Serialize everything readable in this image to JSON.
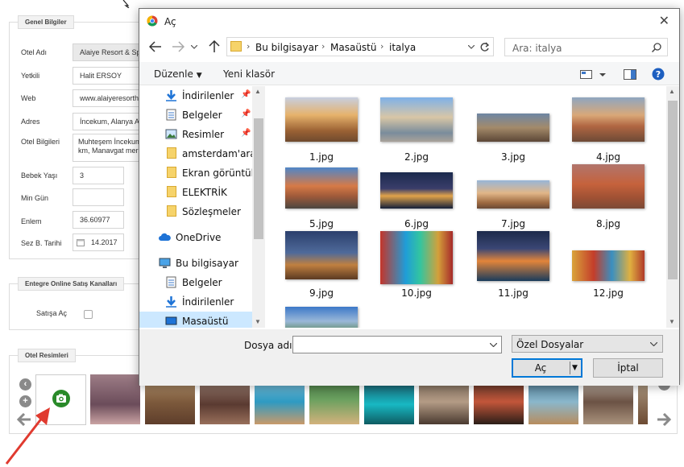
{
  "form": {
    "general_legend": "Genel Bilgiler",
    "fields": [
      {
        "label": "Otel Adı",
        "value": "Alaiye Resort & Spa H"
      },
      {
        "label": "Yetkili",
        "value": "Halit ERSOY"
      },
      {
        "label": "Web",
        "value": "www.alaiyeresorthot"
      },
      {
        "label": "Adres",
        "value": "İncekum,  Alanya Ant"
      },
      {
        "label": "Otel Bilgileri",
        "value_line1": "Muhteşem İncekum p",
        "value_line2": "km, Manavgat merke"
      },
      {
        "label": "Bebek Yaşı",
        "value": "3"
      },
      {
        "label": "Min Gün",
        "value": ""
      },
      {
        "label": "Enlem",
        "value": "36.60977"
      },
      {
        "label": "Sez B. Tarihi",
        "value": "14.2017"
      }
    ],
    "online_legend": "Entegre Online Satış Kanalları",
    "sales_open_label": "Satışa Aç",
    "images_legend": "Otel Resimleri"
  },
  "dialog": {
    "title": "Aç",
    "close_glyph": "✕",
    "breadcrumb": [
      "Bu bilgisayar",
      "Masaüstü",
      "italya"
    ],
    "search_placeholder": "Ara: italya",
    "toolbar": {
      "organize": "Düzenle",
      "new_folder": "Yeni klasör"
    },
    "nav_items": [
      {
        "label": "İndirilenler",
        "icon": "download-icon",
        "pinned": true
      },
      {
        "label": "Belgeler",
        "icon": "documents-icon",
        "pinned": true
      },
      {
        "label": "Resimler",
        "icon": "pictures-icon",
        "pinned": true
      },
      {
        "label": "amsterdam'aralı",
        "icon": "folder-icon",
        "pinned": false
      },
      {
        "label": "Ekran görüntüler",
        "icon": "folder-icon",
        "pinned": false
      },
      {
        "label": "ELEKTRİK",
        "icon": "folder-icon",
        "pinned": false
      },
      {
        "label": "Sözleşmeler",
        "icon": "folder-icon",
        "pinned": false
      },
      {
        "label": "OneDrive",
        "icon": "cloud-icon",
        "pinned": false
      },
      {
        "label": "Bu bilgisayar",
        "icon": "computer-icon",
        "pinned": false
      },
      {
        "label": "Belgeler",
        "icon": "documents-icon",
        "pinned": false
      },
      {
        "label": "İndirilenler",
        "icon": "download-icon",
        "pinned": false
      },
      {
        "label": "Masaüstü",
        "icon": "desktop-icon",
        "pinned": false
      }
    ],
    "files": [
      "1.jpg",
      "2.jpg",
      "3.jpg",
      "4.jpg",
      "5.jpg",
      "6.jpg",
      "7.jpg",
      "8.jpg",
      "9.jpg",
      "10.jpg",
      "11.jpg",
      "12.jpg",
      ""
    ],
    "filename_label": "Dosya adı:",
    "filename_value": "",
    "filter_value": "Özel Dosyalar",
    "open_button": "Aç",
    "cancel_button": "İptal"
  },
  "colors": {
    "accent": "#0078d7",
    "selected": "#cce8ff",
    "arrow": "#e03a2f"
  }
}
